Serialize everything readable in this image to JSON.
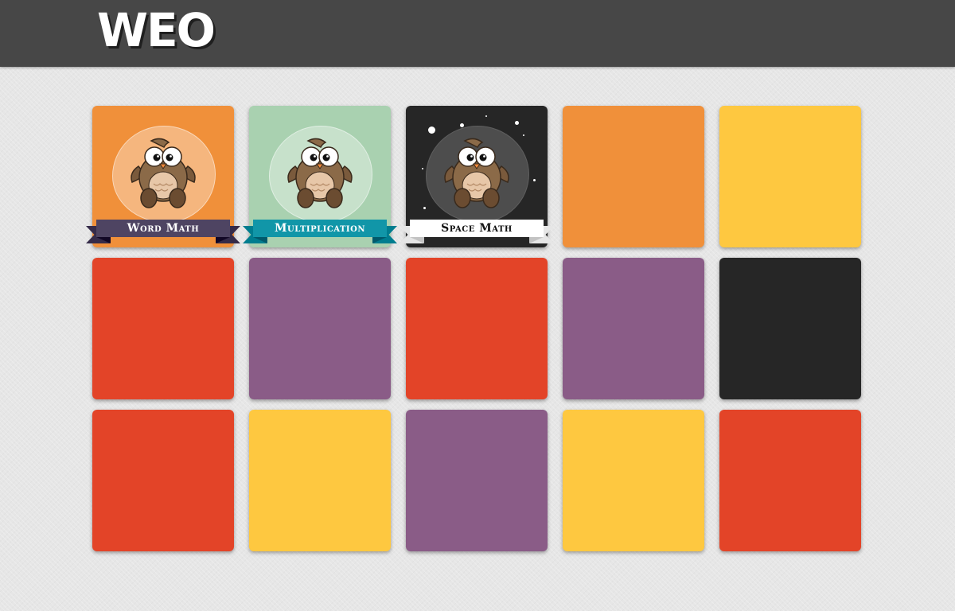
{
  "header": {
    "logo_text": "WEO",
    "background": "#474747"
  },
  "tiles": [
    {
      "label": "Word Math",
      "color": "#f0903a",
      "ribbon": "#4e4462",
      "ribbon_text": "#ffffff",
      "bubble": "light"
    },
    {
      "label": "Multiplication",
      "color": "#a9d1b0",
      "ribbon": "#1196a8",
      "ribbon_text": "#ffffff",
      "bubble": "light"
    },
    {
      "label": "Space Math",
      "color": "#262626",
      "ribbon": "#ffffff",
      "ribbon_text": "#111111",
      "bubble": "dark"
    },
    {
      "label": "",
      "color": "#f0903a"
    },
    {
      "label": "",
      "color": "#fec840"
    },
    {
      "label": "",
      "color": "#e34428"
    },
    {
      "label": "",
      "color": "#8a5c87"
    },
    {
      "label": "",
      "color": "#e34428"
    },
    {
      "label": "",
      "color": "#8a5c87"
    },
    {
      "label": "",
      "color": "#262626"
    },
    {
      "label": "",
      "color": "#e34428"
    },
    {
      "label": "",
      "color": "#fec840"
    },
    {
      "label": "",
      "color": "#8a5c87"
    },
    {
      "label": "",
      "color": "#fec840"
    },
    {
      "label": "",
      "color": "#e34428"
    }
  ]
}
